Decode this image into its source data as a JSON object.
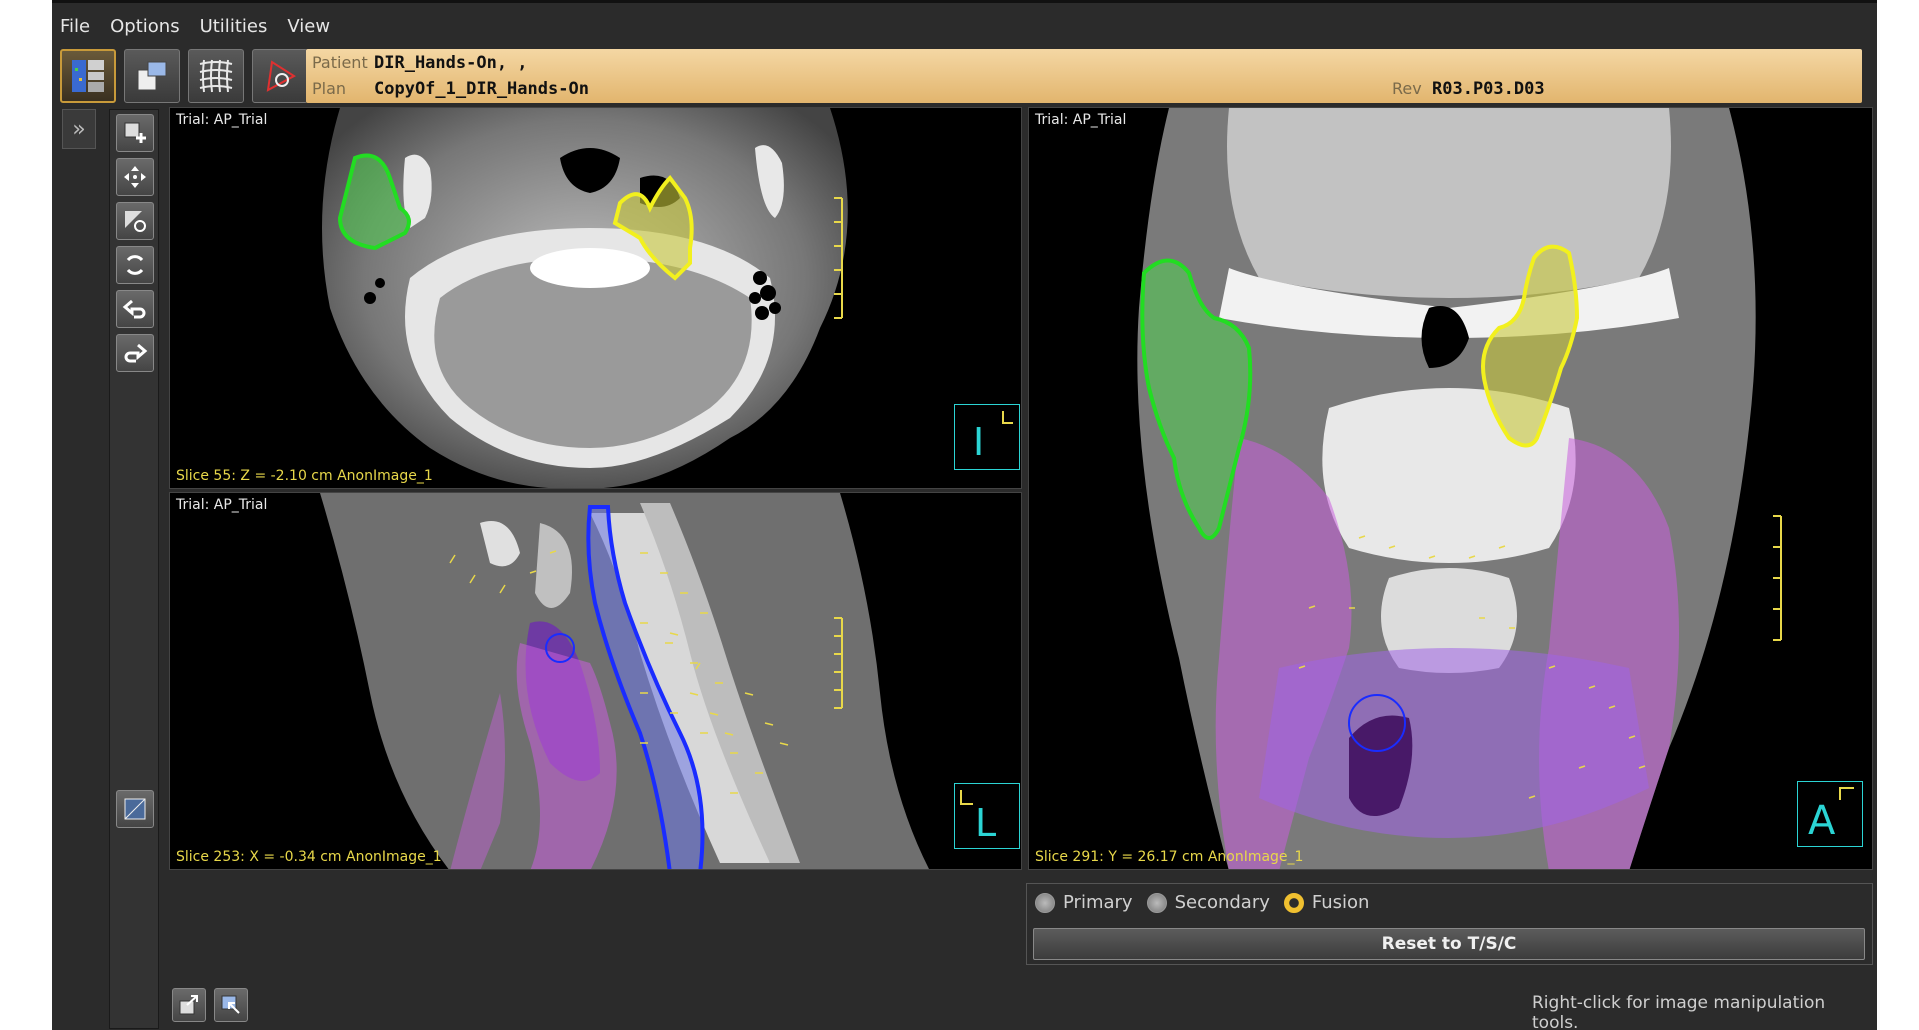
{
  "menu": [
    "File",
    "Options",
    "Utilities",
    "View"
  ],
  "toolbar": {
    "icons": [
      "layout-icon",
      "tools-icon",
      "grid-deform-icon",
      "contour-icon"
    ]
  },
  "patient_bar": {
    "patient_key": "Patient",
    "patient_value": "DIR_Hands-On, ,",
    "plan_key": "Plan",
    "plan_value": "CopyOf_1_DIR_Hands-On",
    "rev_key": "Rev",
    "rev_value": "R03.P03.D03"
  },
  "sidebar": {
    "expander": "»",
    "tools": [
      "zoom-in-icon",
      "pan-icon",
      "window-level-icon",
      "rotate-icon",
      "undo-icon",
      "redo-icon",
      "image-icon"
    ]
  },
  "viewports": {
    "axial": {
      "trial": "Trial: AP_Trial",
      "slice": "Slice 55: Z = -2.10 cm AnonImage_1",
      "orientation": "I"
    },
    "sagittal": {
      "trial": "Trial: AP_Trial",
      "slice": "Slice 253: X = -0.34 cm AnonImage_1",
      "orientation": "L"
    },
    "coronal": {
      "trial": "Trial: AP_Trial",
      "slice": "Slice 291: Y = 26.17 cm AnonImage_1",
      "orientation": "A"
    }
  },
  "image_mode": {
    "options": [
      "Primary",
      "Secondary",
      "Fusion"
    ],
    "selected": "Fusion"
  },
  "reset_button": "Reset to T/S/C",
  "status_hint": "Right-click for image manipulation tools.",
  "colors": {
    "contour_green": "#22dd22",
    "contour_yellow": "#f2f01e",
    "contour_blue": "#1a2cff",
    "fusion_magenta": "#c05fd8",
    "accent_cyan": "#2bd4d4",
    "label_yellow": "#e8d84a"
  }
}
